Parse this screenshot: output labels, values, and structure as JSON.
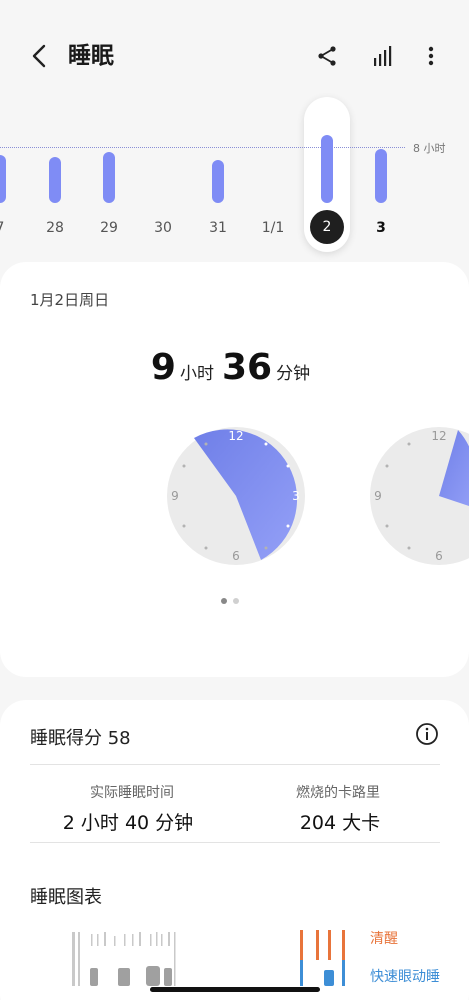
{
  "header": {
    "title": "睡眠"
  },
  "week_chart": {
    "goal_label": "8 小时",
    "days": [
      {
        "label": "7",
        "hours": 5.2
      },
      {
        "label": "28",
        "hours": 5.0
      },
      {
        "label": "29",
        "hours": 5.5
      },
      {
        "label": "30",
        "hours": 0
      },
      {
        "label": "31",
        "hours": 4.6
      },
      {
        "label": "1/1",
        "hours": 0
      },
      {
        "label": "2",
        "hours": 7.3,
        "selected": true
      },
      {
        "label": "3",
        "hours": 5.8,
        "bold": true
      }
    ]
  },
  "summary": {
    "date": "1月2日周日",
    "hours_value": "9",
    "hours_unit": "小时",
    "minutes_value": "36",
    "minutes_unit": "分钟",
    "clock_labels": {
      "twelve": "12",
      "three": "3",
      "six": "6",
      "nine": "9"
    },
    "page_count": 2,
    "active_page": 0
  },
  "score": {
    "title": "睡眠得分 58",
    "actual_sleep_label": "实际睡眠时间",
    "actual_sleep_value": "2 小时 40 分钟",
    "calories_label": "燃烧的卡路里",
    "calories_value": "204 大卡",
    "chart_title": "睡眠图表",
    "legend_wake": "清醒",
    "legend_rem": "快速眼动睡"
  },
  "colors": {
    "accent": "#7f8cf5",
    "wake": "#e8743b",
    "rem": "#3d8ed6"
  }
}
